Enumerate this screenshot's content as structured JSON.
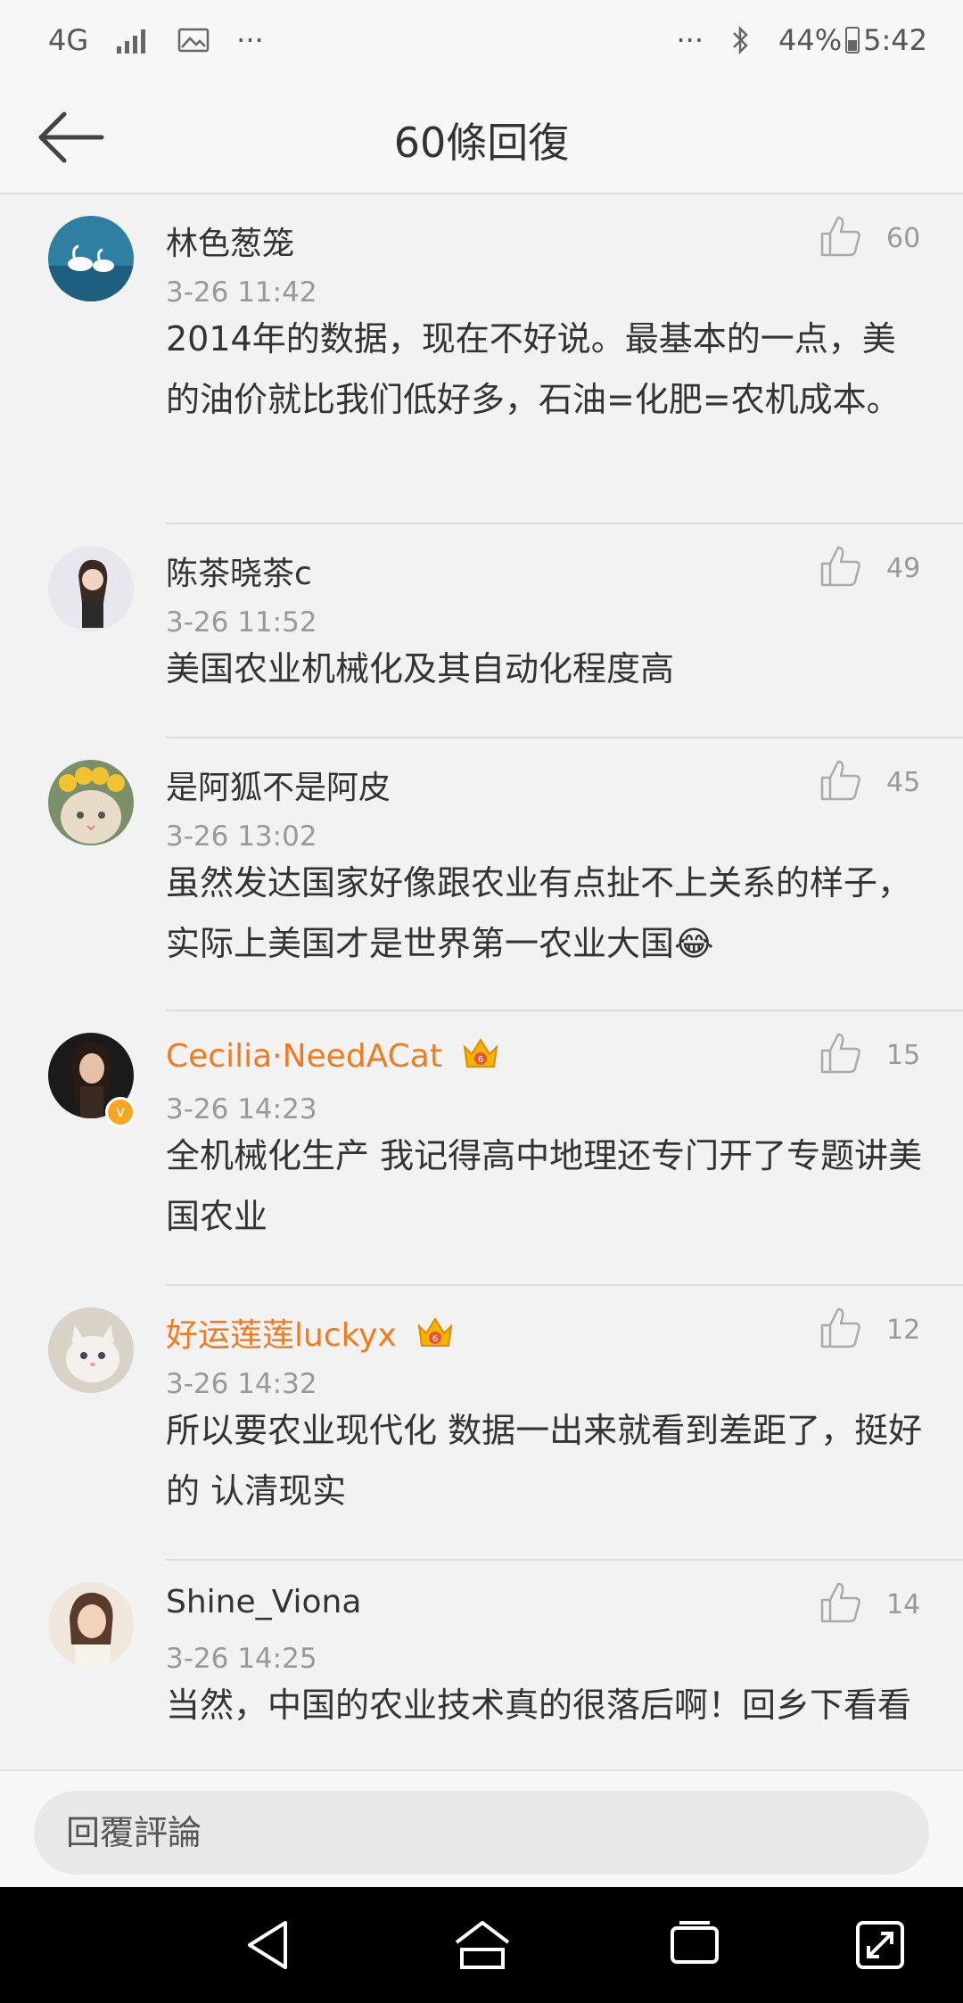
{
  "status_bar": {
    "network": "4G",
    "more_left": "···",
    "more_right": "···",
    "battery": "44%",
    "time": "5:42"
  },
  "header": {
    "title": "60條回復"
  },
  "comments": [
    {
      "username": "林色葱笼",
      "time": "3-26 11:42",
      "text": "2014年的数据，现在不好说。最基本的一点，美的油价就比我们低好多，石油=化肥=农机成本。",
      "likes": "60"
    },
    {
      "username": "陈茶晓茶c",
      "time": "3-26 11:52",
      "text": "美国农业机械化及其自动化程度高",
      "likes": "49"
    },
    {
      "username": "是阿狐不是阿皮",
      "time": "3-26 13:02",
      "text": "虽然发达国家好像跟农业有点扯不上关系的样子，实际上美国才是世界第一农业大国😂",
      "likes": "45"
    },
    {
      "username": "Cecilia·NeedACat",
      "time": "3-26 14:23",
      "text": "全机械化生产 我记得高中地理还专门开了专题讲美国农业",
      "likes": "15",
      "vip_level": "6"
    },
    {
      "username": "好运莲莲luckyx",
      "time": "3-26 14:32",
      "text": "所以要农业现代化 数据一出来就看到差距了，挺好的 认清现实",
      "likes": "12",
      "vip_level": "6"
    },
    {
      "username": "Shine_Viona",
      "time": "3-26 14:25",
      "text": "当然，中国的农业技术真的很落后啊！回乡下看看",
      "likes": "14"
    }
  ],
  "reply": {
    "placeholder": "回覆評論"
  },
  "colors": {
    "vip_name": "#f07a1e",
    "muted": "#999999",
    "verified": "#f6a623",
    "background": "#f2f2f2"
  },
  "icons": [
    "back-arrow-icon",
    "like-icon",
    "crown-icon",
    "bluetooth-icon",
    "signal-icon",
    "image-icon",
    "nav-back-icon",
    "nav-home-icon",
    "nav-recents-icon",
    "nav-rotate-icon"
  ]
}
